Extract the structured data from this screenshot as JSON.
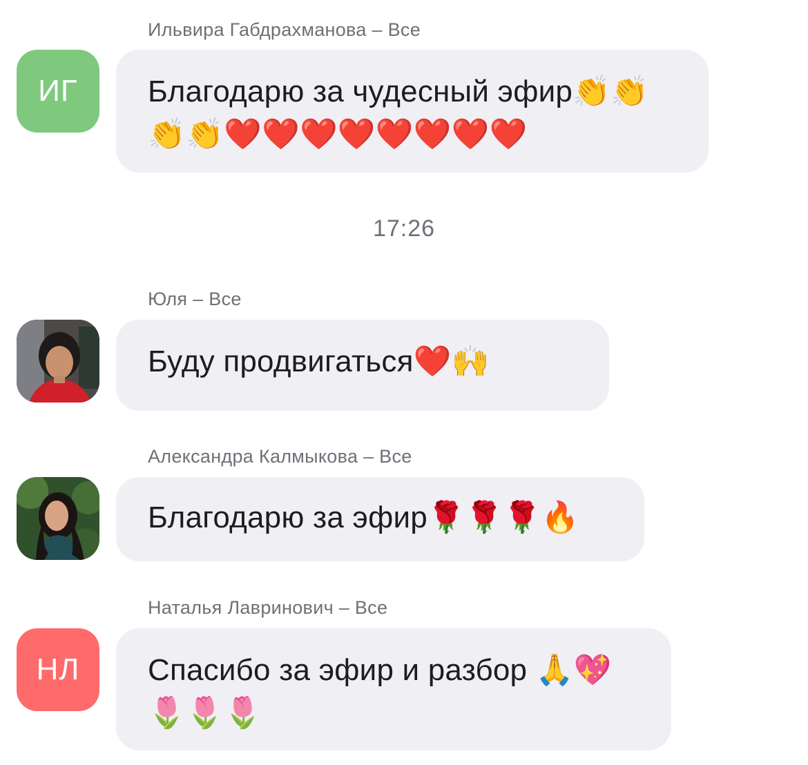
{
  "messages": [
    {
      "sender": "Ильвира Габдрахманова – Все",
      "avatar": {
        "initials": "ИГ",
        "color": "#7fc97f"
      },
      "lines": [
        "Благодарю за чудесный эфир👏👏",
        "👏👏❤️❤️❤️❤️❤️❤️❤️❤️"
      ]
    },
    {
      "sender": "Юля – Все",
      "avatar": {
        "type": "photo"
      },
      "lines": [
        "Буду продвигаться❤️🙌"
      ]
    },
    {
      "sender": "Александра Калмыкова – Все",
      "avatar": {
        "type": "photo"
      },
      "lines": [
        "Благодарю за эфир🌹🌹🌹🔥"
      ]
    },
    {
      "sender": "Наталья Лавринович – Все",
      "avatar": {
        "initials": "НЛ",
        "color": "#ff6b6b"
      },
      "lines": [
        "Спасибо за эфир и разбор 🙏💖",
        "🌷🌷🌷"
      ]
    }
  ],
  "timestamp": "17:26",
  "colors": {
    "bubble": "#efeff4",
    "sender_text": "#6f6f77",
    "message_text": "#1c1c22"
  }
}
